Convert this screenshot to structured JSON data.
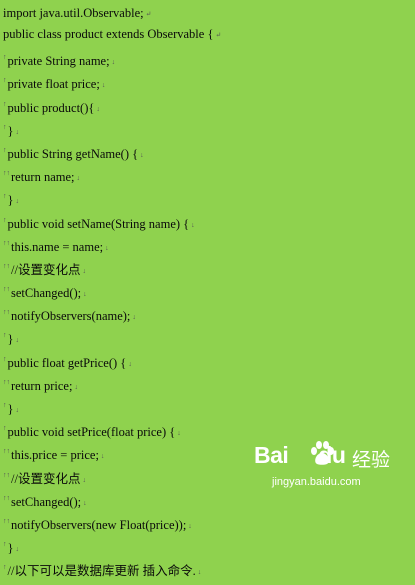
{
  "document": {
    "lines": [
      {
        "indent": "",
        "text": "import java.util.Observable;",
        "mark": "↵"
      },
      {
        "indent": "",
        "text": "public class product extends Observable {",
        "mark": "↵"
      },
      {
        "indent": "↑",
        "text": "private String name;",
        "mark": "↓"
      },
      {
        "indent": "↑",
        "text": "private float price;",
        "mark": "↓"
      },
      {
        "indent": "↑",
        "text": "public product(){",
        "mark": "↓"
      },
      {
        "indent": "↑",
        "text": "}",
        "mark": "↓"
      },
      {
        "indent": "↑",
        "text": "public String getName() {",
        "mark": "↓"
      },
      {
        "indent": "↑↑",
        "text": "return name;",
        "mark": "↓"
      },
      {
        "indent": "↑",
        "text": "}",
        "mark": "↓"
      },
      {
        "indent": "↑",
        "text": "public void setName(String name) {",
        "mark": "↓"
      },
      {
        "indent": "↑↑",
        "text": "this.name = name;",
        "mark": "↓"
      },
      {
        "indent": "↑↑",
        "text": "//设置变化点",
        "mark": "↓"
      },
      {
        "indent": "↑↑",
        "text": "setChanged();",
        "mark": "↓"
      },
      {
        "indent": "↑↑",
        "text": "notifyObservers(name);",
        "mark": "↓"
      },
      {
        "indent": "↑",
        "text": "}",
        "mark": "↓"
      },
      {
        "indent": "↑",
        "text": "public float getPrice() {",
        "mark": "↓"
      },
      {
        "indent": "↑↑",
        "text": "return price;",
        "mark": "↓"
      },
      {
        "indent": "↑",
        "text": "}",
        "mark": "↓"
      },
      {
        "indent": "↑",
        "text": "public void setPrice(float price) {",
        "mark": "↓"
      },
      {
        "indent": "↑↑",
        "text": "this.price = price;",
        "mark": "↓"
      },
      {
        "indent": "↑↑",
        "text": "//设置变化点",
        "mark": "↓"
      },
      {
        "indent": "↑↑",
        "text": "setChanged();",
        "mark": "↓"
      },
      {
        "indent": "↑↑",
        "text": "notifyObservers(new Float(price));",
        "mark": "↓"
      },
      {
        "indent": "↑",
        "text": "}",
        "mark": "↓"
      },
      {
        "indent": "↑",
        "text": "//以下可以是数据库更新 插入命令.",
        "mark": "↓"
      }
    ]
  },
  "watermark": {
    "logo_text": "Bai",
    "logo_text_2": "du",
    "cn_text": "经验",
    "url": "jingyan.baidu.com",
    "icon": "baidu-paw-icon"
  }
}
